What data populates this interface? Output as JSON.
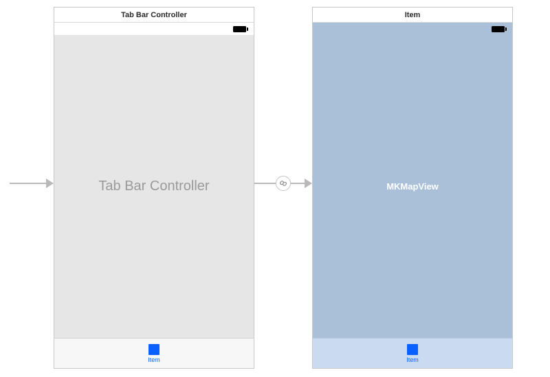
{
  "scenes": {
    "left": {
      "title": "Tab Bar Controller",
      "content_label": "Tab Bar Controller",
      "tab_item_label": "Item"
    },
    "right": {
      "title": "Item",
      "content_label": "MKMapView",
      "tab_item_label": "Item"
    }
  }
}
